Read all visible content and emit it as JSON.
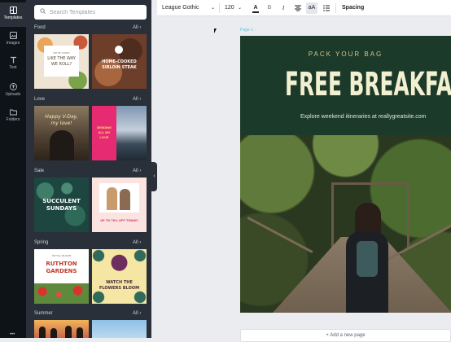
{
  "rail": {
    "items": [
      {
        "label": "Templates",
        "icon": "templates-icon"
      },
      {
        "label": "Images",
        "icon": "image-icon"
      },
      {
        "label": "Text",
        "icon": "text-icon"
      },
      {
        "label": "Uploads",
        "icon": "upload-icon"
      },
      {
        "label": "Folders",
        "icon": "folder-icon"
      }
    ]
  },
  "panel": {
    "search_placeholder": "Search Templates",
    "all_label": "All",
    "sections": [
      {
        "title": "Food",
        "templates": [
          {
            "lines": [
              "WE'RE SORRY",
              "LIKE THE WAY",
              "WE ROLL?"
            ]
          },
          {
            "lines": [
              "HOME-COOKED",
              "SIRLOIN STEAK"
            ]
          }
        ]
      },
      {
        "title": "Love",
        "templates": [
          {
            "lines": [
              "Happy V-Day,",
              "my love!"
            ]
          },
          {
            "lines": [
              "SENDING",
              "ALL MY",
              "LOVE"
            ]
          }
        ]
      },
      {
        "title": "Sale",
        "templates": [
          {
            "lines": [
              "SUCCULENT",
              "SUNDAYS"
            ]
          },
          {
            "lines": [
              "UP TO 70% OFF TODAY!"
            ]
          }
        ]
      },
      {
        "title": "Spring",
        "templates": [
          {
            "lines": [
              "IN FULL BLOOM",
              "RUTHTON",
              "GARDENS"
            ]
          },
          {
            "lines": [
              "WATCH THE",
              "FLOWERS BLOOM"
            ]
          }
        ]
      },
      {
        "title": "Summer",
        "templates": []
      }
    ]
  },
  "toolbar": {
    "font_family": "League Gothic",
    "font_size": "120",
    "text_color_glyph": "A",
    "bold_glyph": "B",
    "italic_glyph": "I",
    "case_glyph": "aA",
    "spacing_label": "Spacing"
  },
  "canvas": {
    "page_label": "Page 1 -",
    "eyebrow": "PACK YOUR BAG",
    "headline": "FREE BREAKFAS",
    "subline": "Explore weekend itineraries at reallygreatsite.com",
    "add_page": "+ Add a new page"
  },
  "colors": {
    "rail_bg": "#0e1318",
    "panel_bg": "#293039",
    "banner_bg": "#1c3a2a",
    "headline": "#f3f0d2",
    "eyebrow": "#d4c48a",
    "accent": "#5ec3cf"
  }
}
